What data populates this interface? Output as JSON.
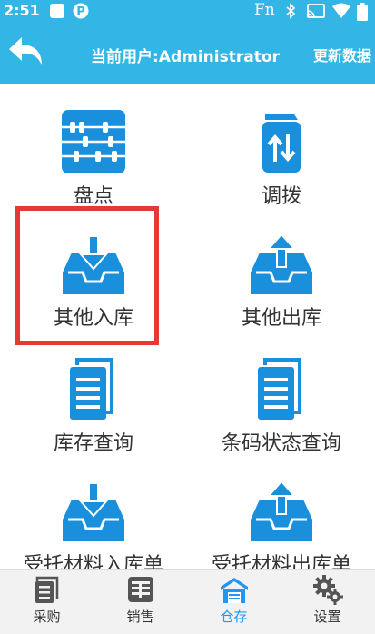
{
  "status_bar": {
    "time": "2:51",
    "fn_label": "Fn"
  },
  "header": {
    "back_icon": "back-arrow-icon",
    "user_label": "当前用户:Administrator",
    "update_button": "更新数据"
  },
  "colors": {
    "primary": "#33b5e5",
    "icon_blue": "#1a8fdc",
    "highlight_red": "#e53935",
    "nav_active": "#2196f3",
    "nav_inactive": "#555555"
  },
  "grid": {
    "items": [
      {
        "label": "盘点",
        "icon": "abacus-icon"
      },
      {
        "label": "调拨",
        "icon": "transfer-icon"
      },
      {
        "label": "其他入库",
        "icon": "inbox-in-icon",
        "highlighted": true
      },
      {
        "label": "其他出库",
        "icon": "inbox-out-icon"
      },
      {
        "label": "库存查询",
        "icon": "document-icon"
      },
      {
        "label": "条码状态查询",
        "icon": "document-icon"
      },
      {
        "label": "受托材料入库单",
        "icon": "inbox-in-icon"
      },
      {
        "label": "受托材料出库单",
        "icon": "inbox-out-icon"
      }
    ]
  },
  "bottom_nav": {
    "items": [
      {
        "label": "采购",
        "icon": "purchase-icon",
        "active": false
      },
      {
        "label": "销售",
        "icon": "sales-icon",
        "active": false
      },
      {
        "label": "仓存",
        "icon": "warehouse-icon",
        "active": true
      },
      {
        "label": "设置",
        "icon": "settings-gear-icon",
        "active": false
      }
    ]
  }
}
